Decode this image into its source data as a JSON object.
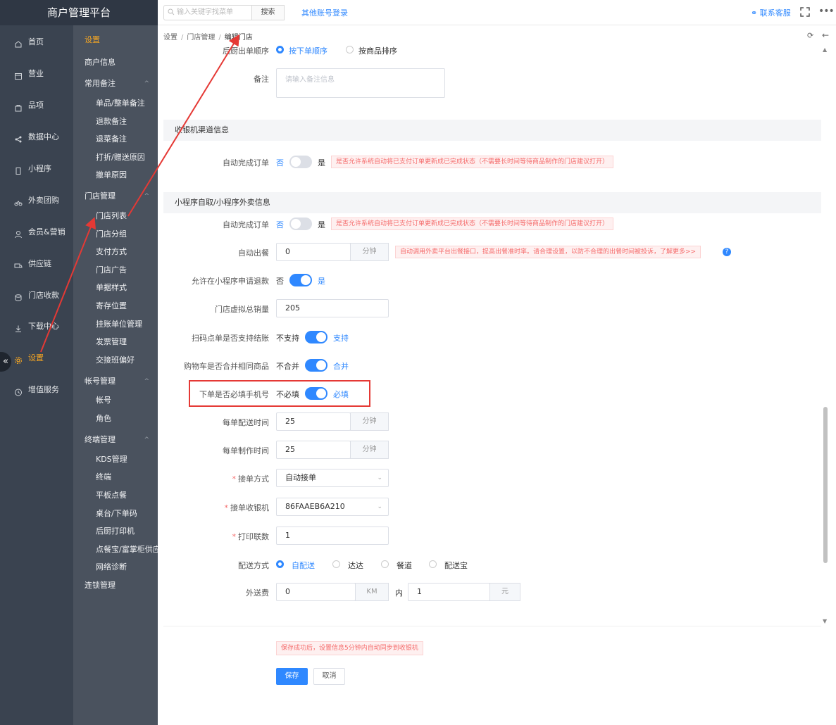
{
  "app": {
    "title": "商户管理平台"
  },
  "nav": {
    "items": [
      {
        "label": "首页",
        "icon": "home-icon"
      },
      {
        "label": "营业",
        "icon": "calendar-icon"
      },
      {
        "label": "品项",
        "icon": "bag-icon"
      },
      {
        "label": "数据中心",
        "icon": "share-icon"
      },
      {
        "label": "小程序",
        "icon": "mobile-icon"
      },
      {
        "label": "外卖团购",
        "icon": "bike-icon"
      },
      {
        "label": "会员&营销",
        "icon": "user-icon"
      },
      {
        "label": "供应链",
        "icon": "truck-icon"
      },
      {
        "label": "门店收款",
        "icon": "coins-icon"
      },
      {
        "label": "下载中心",
        "icon": "download-icon"
      },
      {
        "label": "设置",
        "icon": "gear-icon",
        "active": true
      },
      {
        "label": "增值服务",
        "icon": "clock-icon"
      }
    ],
    "collapse_glyph": "«"
  },
  "submenu": {
    "title": "设置",
    "rows": [
      {
        "label": "商户信息",
        "type": "group"
      },
      {
        "label": "常用备注",
        "type": "group",
        "arrow": "^"
      },
      {
        "label": "单品/整单备注",
        "type": "child"
      },
      {
        "label": "退款备注",
        "type": "child"
      },
      {
        "label": "退菜备注",
        "type": "child"
      },
      {
        "label": "打折/赠送原因",
        "type": "child"
      },
      {
        "label": "撤单原因",
        "type": "child"
      },
      {
        "label": "门店管理",
        "type": "group",
        "arrow": "^"
      },
      {
        "label": "门店列表",
        "type": "child"
      },
      {
        "label": "门店分组",
        "type": "child"
      },
      {
        "label": "支付方式",
        "type": "child"
      },
      {
        "label": "门店广告",
        "type": "child"
      },
      {
        "label": "单据样式",
        "type": "child"
      },
      {
        "label": "寄存位置",
        "type": "child"
      },
      {
        "label": "挂账单位管理",
        "type": "child"
      },
      {
        "label": "发票管理",
        "type": "child"
      },
      {
        "label": "交接班偏好",
        "type": "child"
      },
      {
        "label": "帐号管理",
        "type": "group",
        "arrow": "^"
      },
      {
        "label": "帐号",
        "type": "child"
      },
      {
        "label": "角色",
        "type": "child"
      },
      {
        "label": "终端管理",
        "type": "group",
        "arrow": "^"
      },
      {
        "label": "KDS管理",
        "type": "child"
      },
      {
        "label": "终端",
        "type": "child"
      },
      {
        "label": "平板点餐",
        "type": "child"
      },
      {
        "label": "桌台/下单码",
        "type": "child"
      },
      {
        "label": "后厨打印机",
        "type": "child"
      },
      {
        "label": "点餐宝/富掌柜供应",
        "type": "child"
      },
      {
        "label": "网络诊断",
        "type": "child"
      },
      {
        "label": "连锁管理",
        "type": "group"
      }
    ]
  },
  "header": {
    "search_placeholder": "输入关键字找菜单",
    "search_button": "搜索",
    "other_login": "其他账号登录",
    "contact": "联系客服",
    "more": "•••"
  },
  "breadcrumb": [
    "设置",
    "门店管理",
    "编辑门店"
  ],
  "form": {
    "order_sequence": {
      "label": "后厨出单顺序",
      "options": [
        "按下单顺序",
        "按商品排序"
      ],
      "selected": 0
    },
    "remark": {
      "label": "备注",
      "placeholder": "请输入备注信息"
    },
    "section_cashier": "收银机渠道信息",
    "auto_complete_cashier": {
      "label": "自动完成订单",
      "off": "否",
      "on": "是",
      "value": false,
      "tip": "是否允许系统自动将已支付订单更新成已完成状态（不需要长时间等待商品制作的门店建议打开）"
    },
    "section_miniapp": "小程序自取/小程序外卖信息",
    "auto_complete_miniapp": {
      "label": "自动完成订单",
      "off": "否",
      "on": "是",
      "value": false,
      "tip": "是否允许系统自动将已支付订单更新成已完成状态（不需要长时间等待商品制作的门店建议打开）"
    },
    "auto_dispatch": {
      "label": "自动出餐",
      "value": "0",
      "unit": "分钟",
      "tip": "自动调用外卖平台出餐接口，提高出餐准时率。请合理设置，以防不合理的出餐时间被投诉，了解更多>>",
      "help": "?"
    },
    "allow_refund": {
      "label": "允许在小程序申请退款",
      "off": "否",
      "on": "是",
      "value": true
    },
    "virtual_sales": {
      "label": "门店虚拟总销量",
      "value": "205"
    },
    "scan_checkout": {
      "label": "扫码点单是否支持结账",
      "off": "不支持",
      "on": "支持",
      "value": true
    },
    "cart_merge": {
      "label": "购物车是否合并相同商品",
      "off": "不合并",
      "on": "合并",
      "value": true
    },
    "require_phone": {
      "label": "下单是否必填手机号",
      "off": "不必填",
      "on": "必填",
      "value": true
    },
    "delivery_time": {
      "label": "每单配送时间",
      "value": "25",
      "unit": "分钟"
    },
    "prep_time": {
      "label": "每单制作时间",
      "value": "25",
      "unit": "分钟"
    },
    "accept_mode": {
      "label": "接单方式",
      "value": "自动接单",
      "required": "*"
    },
    "accept_cashier": {
      "label": "接单收银机",
      "value": "86FAAEB6A210",
      "required": "*"
    },
    "print_copies": {
      "label": "打印联数",
      "value": "1",
      "required": "*"
    },
    "delivery_mode": {
      "label": "配送方式",
      "options": [
        "自配送",
        "达达",
        "餐道",
        "配送宝"
      ],
      "selected": 0
    },
    "delivery_fee": {
      "label": "外送费",
      "distance": "0",
      "distance_unit": "KM",
      "within": "内",
      "fee": "1",
      "fee_unit": "元"
    }
  },
  "footer": {
    "note": "保存成功后，设置信息5分钟内自动同步到收银机",
    "save": "保存",
    "cancel": "取消"
  },
  "colors": {
    "accent": "#2f88ff",
    "active_menu": "#f5a623",
    "annotation": "#e53935",
    "sidebar": "#3a4350",
    "submenu": "#4a525e"
  }
}
